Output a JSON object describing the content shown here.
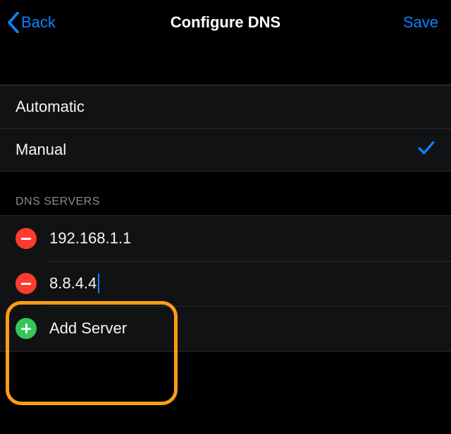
{
  "nav": {
    "back_label": "Back",
    "title": "Configure DNS",
    "save_label": "Save"
  },
  "mode_options": {
    "automatic": "Automatic",
    "manual": "Manual"
  },
  "section_header": "DNS SERVERS",
  "servers": {
    "row0": "192.168.1.1",
    "row1": "8.8.4.4",
    "add_label": "Add Server"
  }
}
